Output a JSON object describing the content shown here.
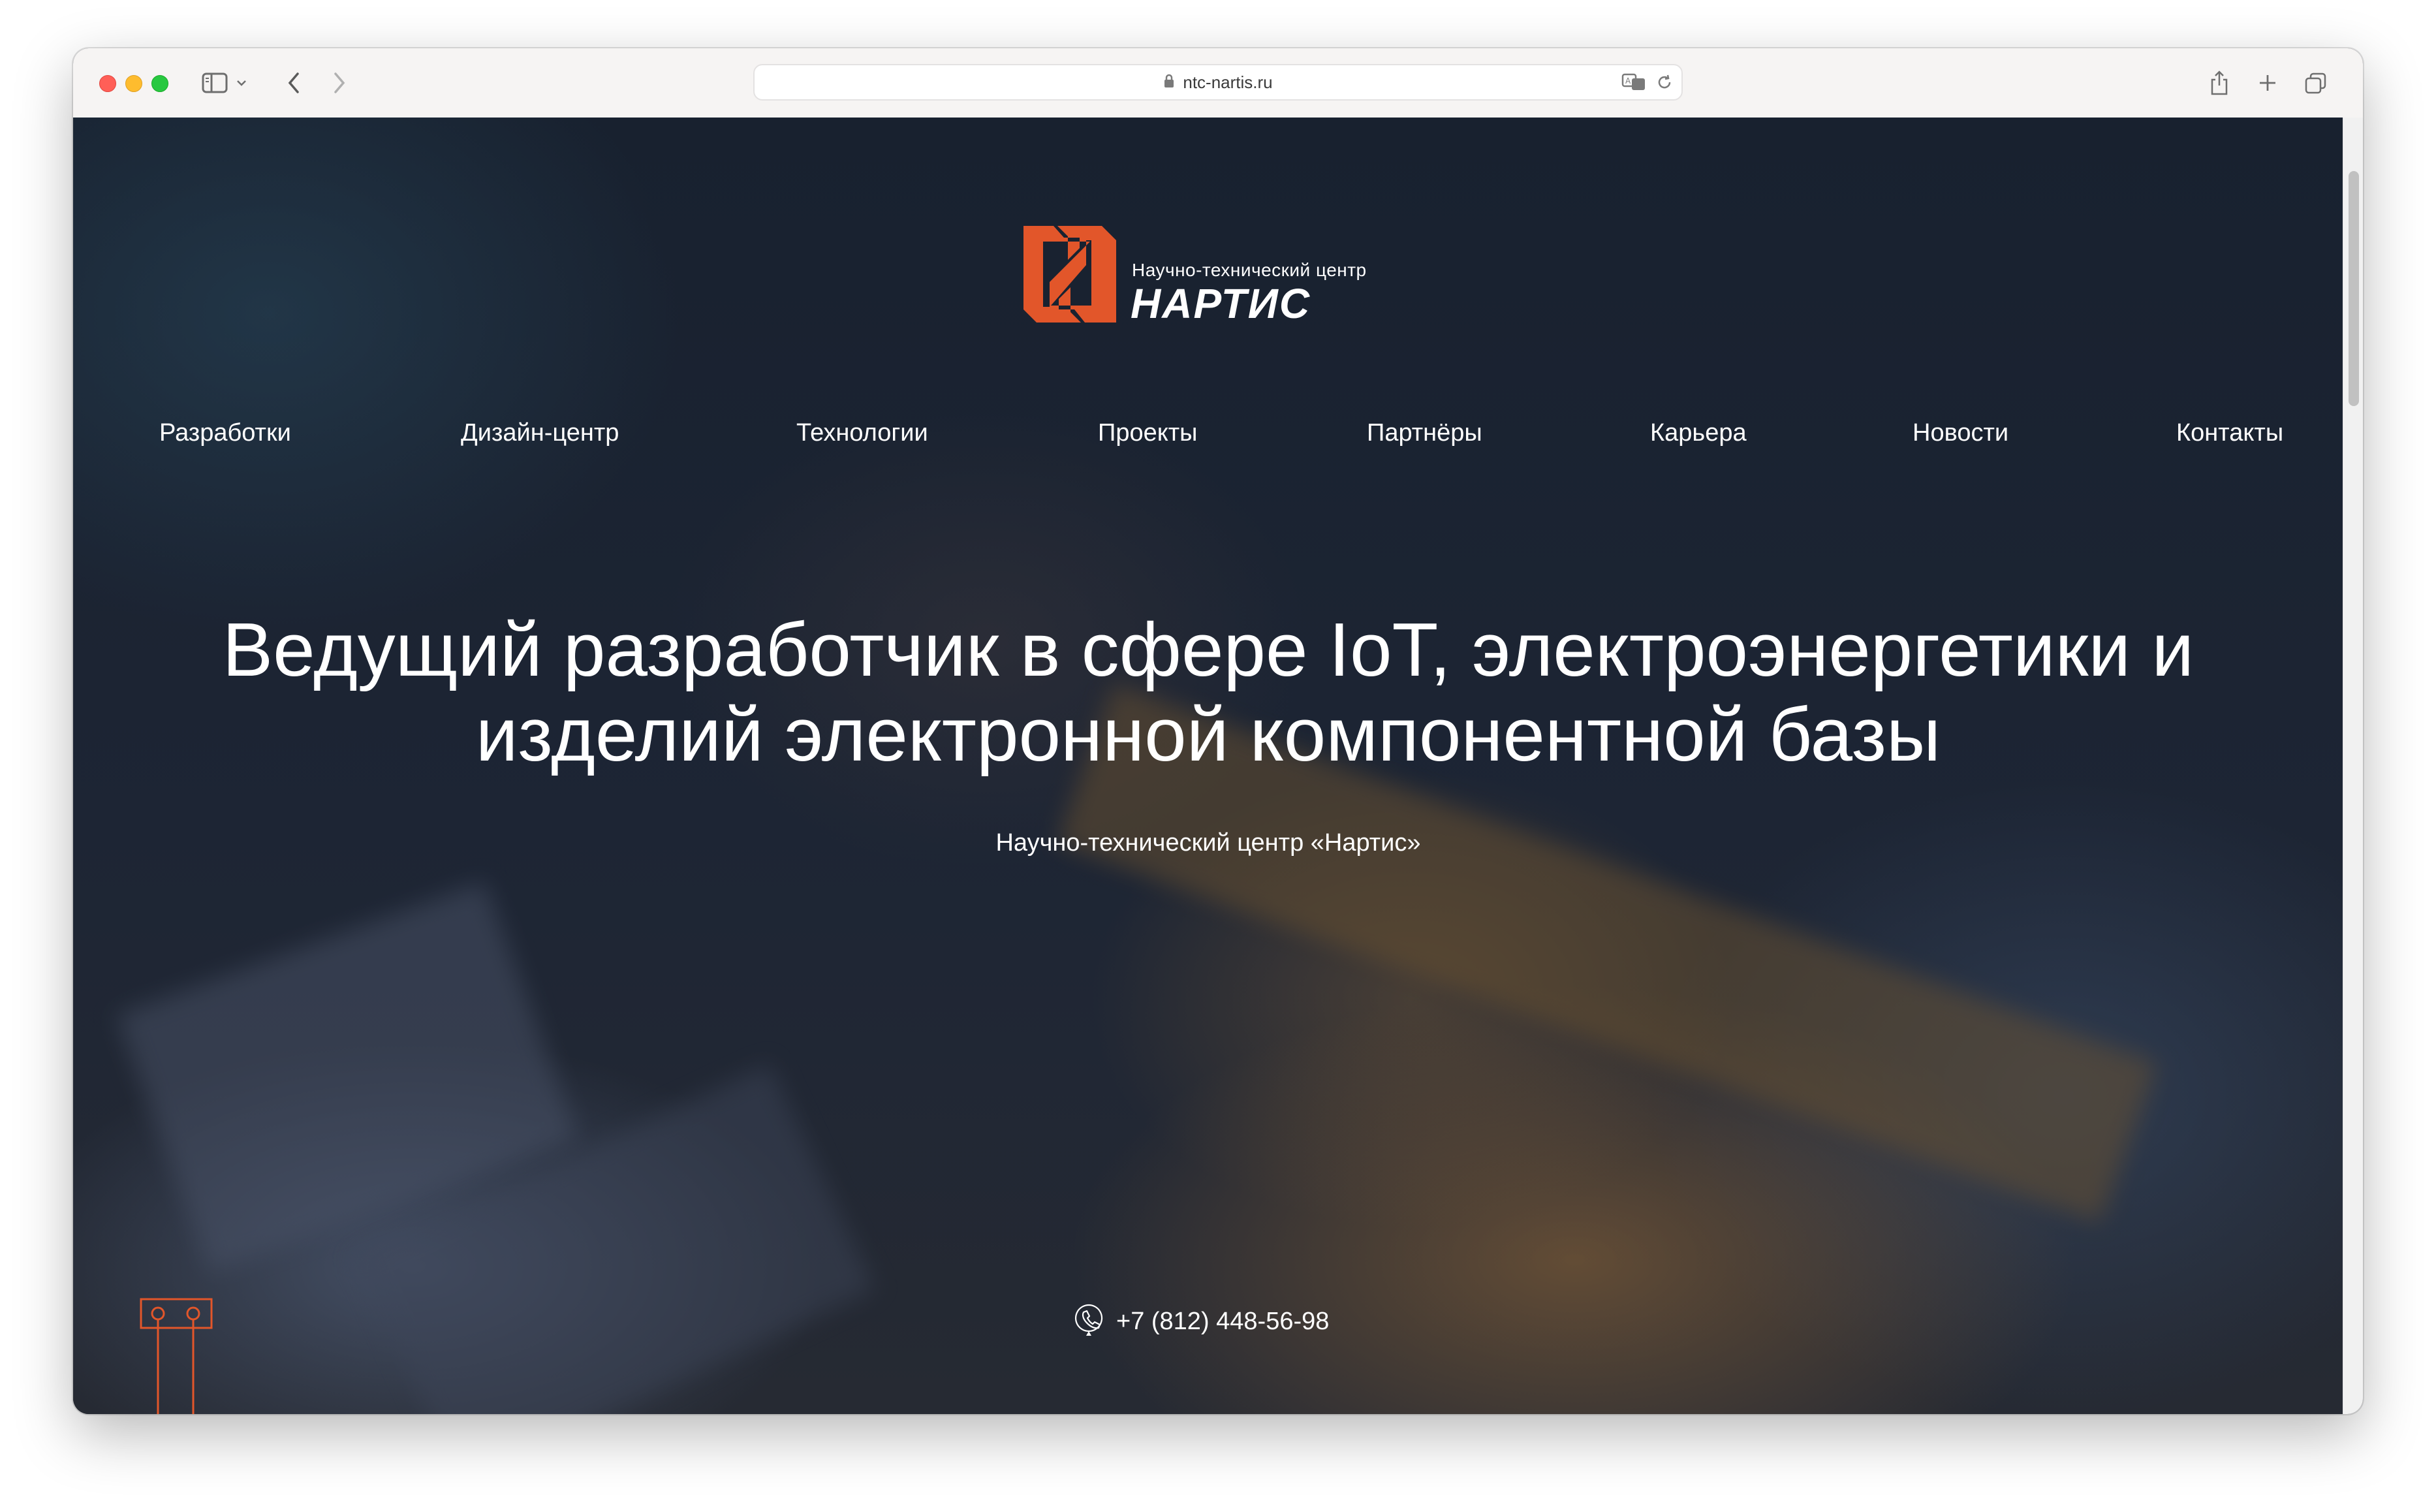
{
  "browser": {
    "url": "ntc-nartis.ru"
  },
  "site": {
    "logo_subtitle": "Научно-технический центр",
    "logo_name": "НАРТИС",
    "nav": [
      {
        "label": "Разработки"
      },
      {
        "label": "Дизайн-центр"
      },
      {
        "label": "Технологии"
      },
      {
        "label": "Проекты"
      },
      {
        "label": "Партнёры"
      },
      {
        "label": "Карьера"
      },
      {
        "label": "Новости"
      },
      {
        "label": "Контакты"
      }
    ],
    "hero_title_line1": "Ведущий разработчик в сфере IoT, электроэнергетики и",
    "hero_title_line2": "изделий электронной компонентной базы",
    "hero_subtitle": "Научно-технический центр «Нартис»",
    "phone": "+7 (812) 448-56-98"
  },
  "colors": {
    "accent": "#e2562a",
    "text": "#ffffff",
    "toolbar": "#f6f4f3"
  },
  "icons": [
    "sidebar-icon",
    "chevron-down-icon",
    "back-icon",
    "forward-icon",
    "lock-icon",
    "translate-icon",
    "reload-icon",
    "share-icon",
    "new-tab-icon",
    "tabs-overview-icon",
    "phone-icon"
  ]
}
